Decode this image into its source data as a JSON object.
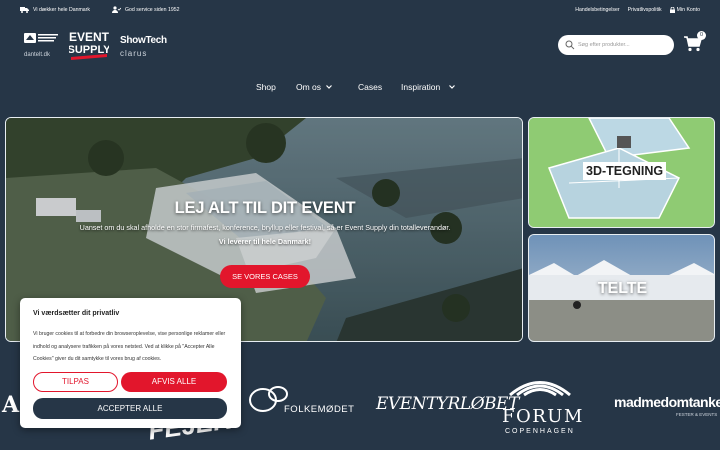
{
  "topbar": {
    "shipping": "Vi dækker hele Danmark",
    "service": "God service siden 1952",
    "links": [
      "Handelsbetingelser",
      "Privatlivspolitik",
      "Min Konto"
    ]
  },
  "logos": {
    "small_text": "dantelt.dk",
    "event_supply_line1": "EVENT",
    "event_supply_line2": "SUPPLY",
    "showtech": "ShowTech",
    "clarus": "clarus"
  },
  "search": {
    "placeholder": "Søg efter produkter..."
  },
  "cart": {
    "count": "0"
  },
  "nav": {
    "items": [
      {
        "label": "Shop"
      },
      {
        "label": "Om os"
      },
      {
        "label": "Cases"
      },
      {
        "label": "Inspiration"
      }
    ]
  },
  "hero": {
    "title": "LEJ ALT TIL DIT EVENT",
    "subtitle": "Uanset om du skal afholde en stor firmafest, konference, bryllup eller festival, så er Event Supply din totalleverandør.",
    "subtitle_bold": "Vi leverer til hele Danmark!",
    "button": "SE VORES CASES"
  },
  "tiles": {
    "tegning": "3D-TEGNING",
    "telte": "TELTE"
  },
  "clients": {
    "folkemodet": "FOLKEMØDET",
    "eventyrlobet": "EVENTYRLØBET",
    "forum": "FORUM",
    "forum_sub": "COPENHAGEN",
    "madmedomtanke": "madmedomtanke",
    "madmedomtanke_sub": "FESTER & EVENTS",
    "partial_left": "A",
    "partial_mid": "FEJER"
  },
  "cookie": {
    "title": "Vi værdsætter dit privatliv",
    "text": "Vi bruger cookies til at forbedre din browseroplevelse, vise personlige reklamer eller indhold og analysere trafikken på vores netsted. Ved at klikke på \"Accepter Alle Cookies\" giver du dit samtykke til vores brug af cookies.",
    "customize": "TILPAS",
    "reject": "AFVIS ALLE",
    "accept": "ACCEPTER ALLE"
  },
  "colors": {
    "background": "#263647",
    "accent_red": "#e2162c",
    "white": "#ffffff"
  }
}
